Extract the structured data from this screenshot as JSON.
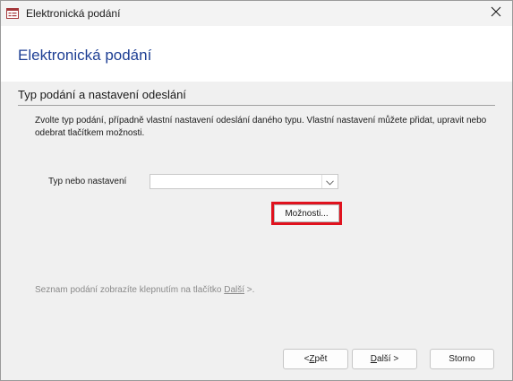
{
  "window": {
    "title": "Elektronická podání",
    "app_icon": "form-window-icon",
    "close_icon": "close-icon"
  },
  "header": {
    "title": "Elektronická podání"
  },
  "step": {
    "title": "Typ podání a nastavení odeslání",
    "description": "Zvolte typ podání, případně vlastní nastavení odeslání daného typu. Vlastní nastavení můžete přidat, upravit nebo odebrat tlačítkem možnosti."
  },
  "form": {
    "type_label": "Typ nebo nastavení",
    "type_value": "",
    "dropdown_icon": "chevron-down-icon",
    "options_button": "Možnosti..."
  },
  "hint": {
    "before": "Seznam podání zobrazíte klepnutím na tlačítko ",
    "link": "Další",
    "after": " >."
  },
  "buttons": {
    "back_mnemonic": "< ",
    "back_u": "Z",
    "back_rest": "pět",
    "next_u": "D",
    "next_rest": "alší >",
    "cancel": "Storno"
  },
  "colors": {
    "header_title": "#1e3f94",
    "highlight": "#e0121e"
  }
}
